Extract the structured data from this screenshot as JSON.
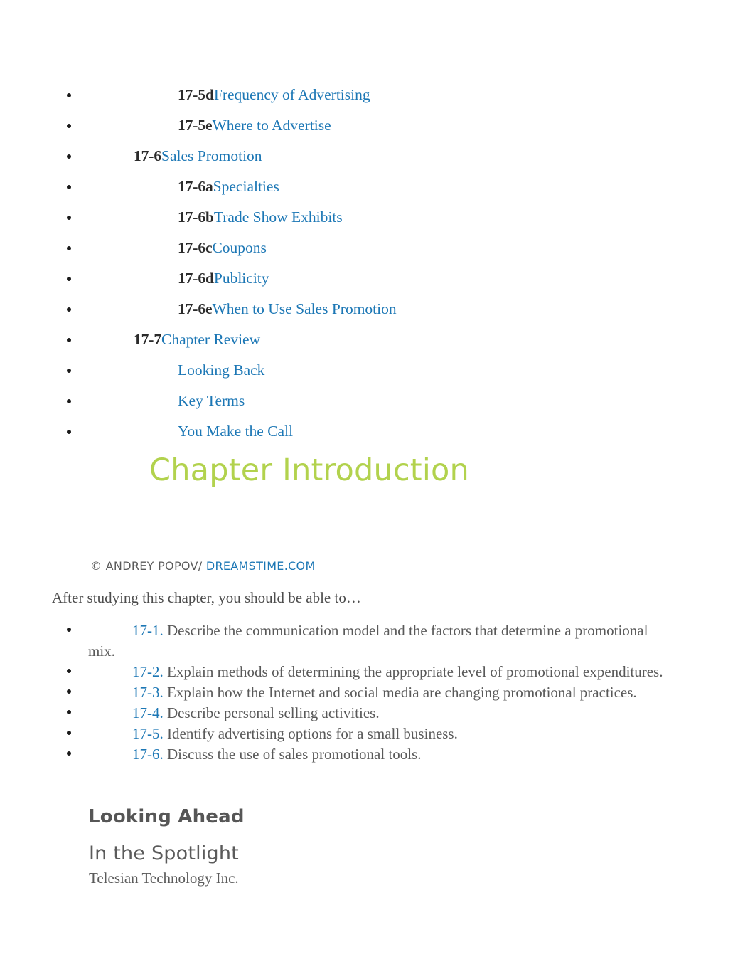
{
  "toc": {
    "items": [
      {
        "level": 2,
        "number": "17-5d",
        "label": "Frequency of Advertising"
      },
      {
        "level": 2,
        "number": "17-5e",
        "label": "Where to Advertise"
      },
      {
        "level": 1,
        "number": "17-6",
        "label": "Sales Promotion"
      },
      {
        "level": 2,
        "number": "17-6a",
        "label": "Specialties"
      },
      {
        "level": 2,
        "number": "17-6b",
        "label": "Trade Show Exhibits"
      },
      {
        "level": 2,
        "number": "17-6c",
        "label": "Coupons"
      },
      {
        "level": 2,
        "number": "17-6d",
        "label": "Publicity"
      },
      {
        "level": 2,
        "number": "17-6e",
        "label": "When to Use Sales Promotion"
      },
      {
        "level": 1,
        "number": "17-7",
        "label": "Chapter Review"
      },
      {
        "level": 2,
        "number": "",
        "label": "Looking Back"
      },
      {
        "level": 2,
        "number": "",
        "label": "Key Terms"
      },
      {
        "level": 2,
        "number": "",
        "label": "You Make the Call"
      }
    ]
  },
  "chapter_intro_heading": "Chapter Introduction",
  "credit": {
    "prefix": "© ANDREY POPOV/ ",
    "link": "DREAMSTIME.COM"
  },
  "intro_line": "After studying this chapter, you should be able to…",
  "objectives": [
    {
      "number": "17-1.",
      "text": " Describe the communication model and the factors that determine a promotional mix."
    },
    {
      "number": "17-2.",
      "text": " Explain methods of determining the appropriate level of promotional expenditures."
    },
    {
      "number": "17-3.",
      "text": " Explain how the Internet and social media are changing promotional practices."
    },
    {
      "number": "17-4.",
      "text": " Describe personal selling activities."
    },
    {
      "number": "17-5.",
      "text": " Identify advertising options for a small business."
    },
    {
      "number": "17-6.",
      "text": " Discuss the use of sales promotional tools."
    }
  ],
  "looking_ahead_heading": "Looking Ahead",
  "spotlight_heading": "In the Spotlight",
  "company_name": "Telesian Technology Inc.",
  "colors": {
    "link_blue": "#1c77b5",
    "heading_green": "#b2d24d",
    "body_gray": "#595959",
    "bold_num": "#2b2b2b"
  }
}
